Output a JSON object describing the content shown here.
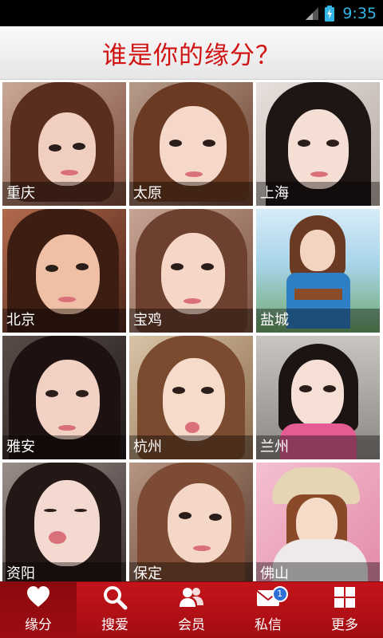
{
  "status_bar": {
    "time": "9:35"
  },
  "header": {
    "title": "谁是你的缘分？"
  },
  "profiles": [
    {
      "city": "重庆"
    },
    {
      "city": "太原"
    },
    {
      "city": "上海"
    },
    {
      "city": "北京"
    },
    {
      "city": "宝鸡"
    },
    {
      "city": "盐城"
    },
    {
      "city": "雅安"
    },
    {
      "city": "杭州"
    },
    {
      "city": "兰州"
    },
    {
      "city": "资阳"
    },
    {
      "city": "保定"
    },
    {
      "city": "佛山"
    }
  ],
  "tabs": [
    {
      "label": "缘分",
      "icon": "heart-icon",
      "active": true
    },
    {
      "label": "搜爱",
      "icon": "search-icon",
      "active": false
    },
    {
      "label": "会员",
      "icon": "members-icon",
      "active": false
    },
    {
      "label": "私信",
      "icon": "mail-icon",
      "active": false,
      "badge": "1"
    },
    {
      "label": "更多",
      "icon": "grid-icon",
      "active": false
    }
  ],
  "colors": {
    "accent": "#d01212",
    "tabbar": "#b3111a",
    "badge": "#2f6fd8",
    "clock": "#33b5e5"
  }
}
